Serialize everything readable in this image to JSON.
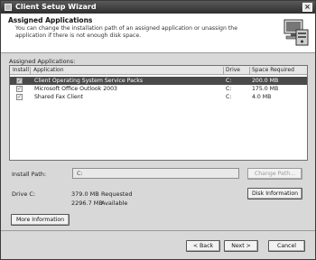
{
  "window": {
    "title": "Client Setup Wizard",
    "close_glyph": "×"
  },
  "header": {
    "title": "Assigned Applications",
    "description": "You can change the installation path of an assigned application or unassign the application if there is not enough disk space."
  },
  "applications": {
    "group_label": "Assigned Applications:",
    "columns": [
      "Install",
      "Application",
      "Drive",
      "Space Required"
    ],
    "rows": [
      {
        "checked": true,
        "application": "Client Operating System Service Packs",
        "drive": "C:",
        "space": "200.0 MB",
        "selected": true
      },
      {
        "checked": true,
        "application": "Microsoft Office Outlook 2003",
        "drive": "C:",
        "space": "175.0 MB",
        "selected": false
      },
      {
        "checked": true,
        "application": "Shared Fax Client",
        "drive": "C:",
        "space": "4.0 MB",
        "selected": false
      }
    ]
  },
  "install_path": {
    "label": "Install Path:",
    "value": "C:",
    "change_button": "Change Path..."
  },
  "drive_info": {
    "label": "Drive C:",
    "requested_value": "379.0 MB",
    "requested_label": "Requested",
    "available_value": "2296.7 MB",
    "available_label": "Available",
    "disk_button": "Disk Information"
  },
  "more_info_button": "More Information",
  "nav": {
    "back": "< Back",
    "next": "Next >",
    "cancel": "Cancel"
  },
  "colors": {
    "title_bar": "#2e2e2e",
    "selection": "#4a4a4a",
    "dialog_bg": "#d8d8d8"
  }
}
